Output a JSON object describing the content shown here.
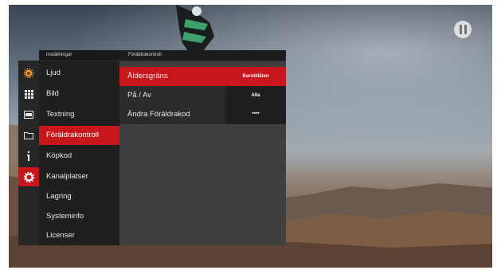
{
  "settings_menu": {
    "header": "Inställningar",
    "items": [
      {
        "label": "Ljud"
      },
      {
        "label": "Bild"
      },
      {
        "label": "Textning"
      },
      {
        "label": "Föräldrakontroll"
      },
      {
        "label": "Köpkod"
      },
      {
        "label": "Kanalplatser"
      },
      {
        "label": "Lagring"
      },
      {
        "label": "Systeminfo"
      },
      {
        "label": "Licenser"
      }
    ],
    "selected": "Föräldrakontroll"
  },
  "icon_bar": {
    "icons": [
      "gear-small-icon",
      "grid-icon",
      "film-icon",
      "folder-icon",
      "info-icon",
      "settings-gear-icon"
    ],
    "active": "settings-gear-icon"
  },
  "parental_control": {
    "header": "Föräldrakontroll",
    "rows": [
      {
        "label": "Åldersgräns",
        "value": "Barntillåten"
      },
      {
        "label": "På / Av",
        "value": "Alla"
      },
      {
        "label": "Ändra Föräldrakod",
        "value": "****"
      }
    ]
  },
  "colors": {
    "accent": "#c8161d",
    "panel_dark": "#1f1f1f",
    "panel_mid": "#3f3f3f"
  },
  "channel_logo": "channel-logo-icon"
}
